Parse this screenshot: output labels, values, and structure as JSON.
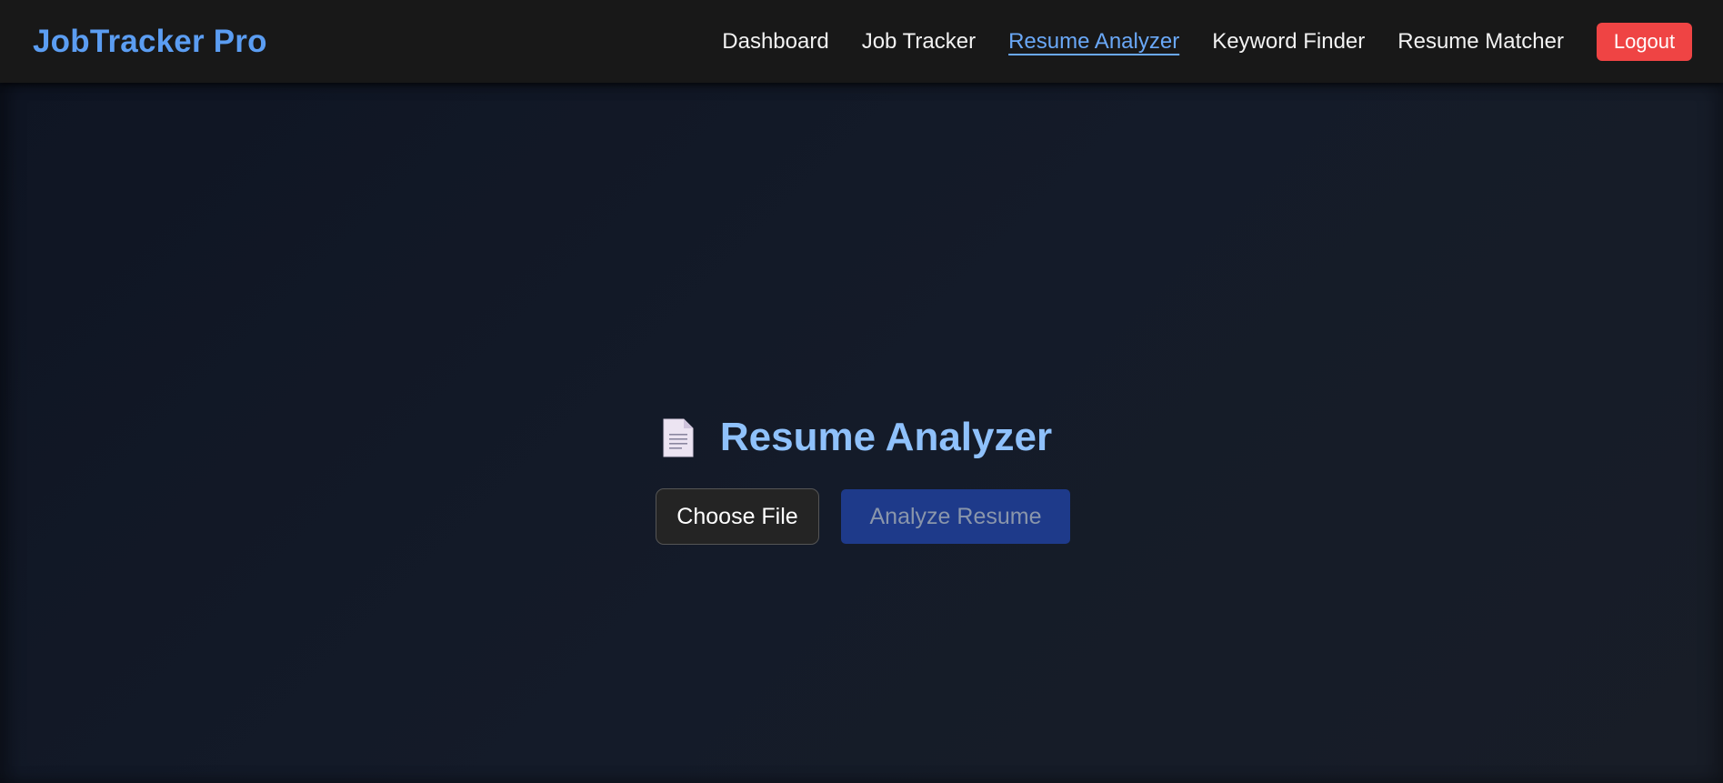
{
  "app": {
    "brand": "JobTracker Pro"
  },
  "nav": {
    "items": [
      {
        "label": "Dashboard",
        "active": false
      },
      {
        "label": "Job Tracker",
        "active": false
      },
      {
        "label": "Resume Analyzer",
        "active": true
      },
      {
        "label": "Keyword Finder",
        "active": false
      },
      {
        "label": "Resume Matcher",
        "active": false
      }
    ],
    "logout_label": "Logout"
  },
  "page": {
    "icon": "document-icon",
    "title": "Resume Analyzer",
    "choose_file_label": "Choose File",
    "analyze_label": "Analyze Resume"
  },
  "colors": {
    "brand": "#5b9df2",
    "active_link": "#6aa8f7",
    "logout": "#ef4444",
    "title": "#8fc1fb",
    "analyze_button": "#1e3a8a",
    "navbar_bg": "#181818",
    "page_bg": "#121826"
  }
}
